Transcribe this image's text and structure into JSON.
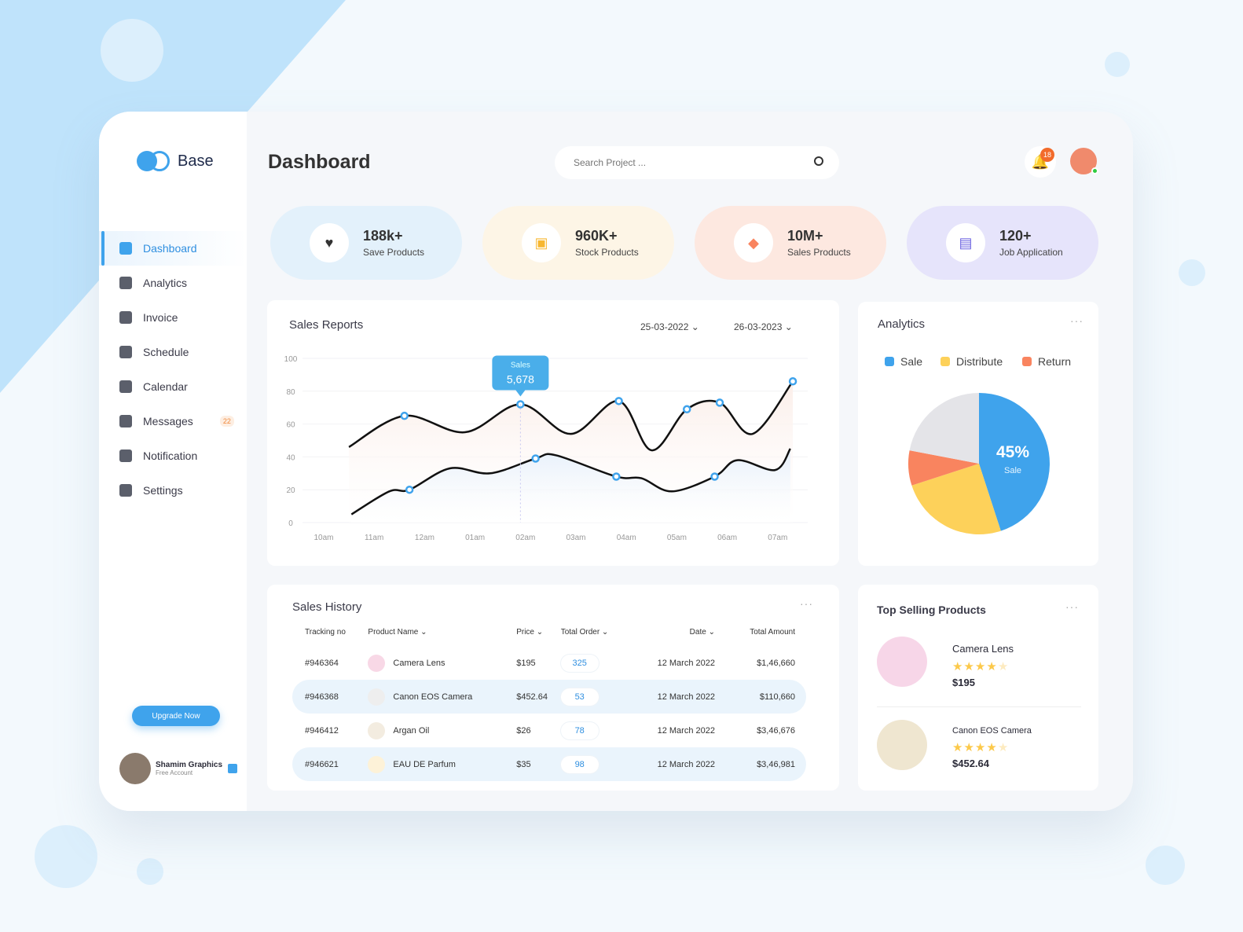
{
  "brand": "Base",
  "header": {
    "title": "Dashboard",
    "search_placeholder": "Search Project ...",
    "notification_count": "18"
  },
  "sidebar": {
    "items": [
      {
        "label": "Dashboard",
        "icon": "grid-icon",
        "active": true
      },
      {
        "label": "Analytics",
        "icon": "bar-chart-icon"
      },
      {
        "label": "Invoice",
        "icon": "invoice-icon"
      },
      {
        "label": "Schedule",
        "icon": "schedule-icon"
      },
      {
        "label": "Calendar",
        "icon": "calendar-icon"
      },
      {
        "label": "Messages",
        "icon": "messages-icon",
        "badge": "22"
      },
      {
        "label": "Notification",
        "icon": "bell-icon"
      },
      {
        "label": "Settings",
        "icon": "gear-icon"
      }
    ],
    "upgrade_label": "Upgrade Now",
    "user": {
      "name": "Shamim Graphics",
      "plan": "Free Account"
    }
  },
  "stats": [
    {
      "value": "188k+",
      "label": "Save Products",
      "icon": "heart-icon",
      "bg": "#e3f1fb"
    },
    {
      "value": "960K+",
      "label": "Stock Products",
      "icon": "box-icon",
      "bg": "#fdf5e6"
    },
    {
      "value": "10M+",
      "label": "Sales Products",
      "icon": "bag-icon",
      "bg": "#fde8e0"
    },
    {
      "value": "120+",
      "label": "Job Application",
      "icon": "briefcase-icon",
      "bg": "#e6e4fb"
    }
  ],
  "sales_report": {
    "title": "Sales Reports",
    "date_from": "25-03-2022",
    "date_to": "26-03-2023",
    "tooltip": {
      "label": "Sales",
      "value": "5,678"
    }
  },
  "chart_data": {
    "type": "line",
    "x_ticks": [
      "10am",
      "11am",
      "12am",
      "01am",
      "02am",
      "03am",
      "04am",
      "05am",
      "06am",
      "07am"
    ],
    "y_ticks": [
      0,
      20,
      40,
      60,
      80,
      100
    ],
    "ylim": [
      0,
      100
    ],
    "grid": true,
    "series": [
      {
        "color": "#111111",
        "fill": "#fbeee9",
        "points": [
          [
            0.5,
            46
          ],
          [
            1.6,
            65
          ],
          [
            2.8,
            55
          ],
          [
            3.9,
            72
          ],
          [
            4.9,
            54
          ],
          [
            5.85,
            74
          ],
          [
            6.5,
            44
          ],
          [
            7.2,
            69
          ],
          [
            7.85,
            73
          ],
          [
            8.5,
            54
          ],
          [
            9.3,
            86
          ]
        ],
        "markers": [
          1,
          3,
          5,
          7,
          8,
          10
        ]
      },
      {
        "color": "#111111",
        "fill": "#e6f0fb",
        "points": [
          [
            0.55,
            5
          ],
          [
            1.3,
            19
          ],
          [
            1.7,
            20
          ],
          [
            2.5,
            33
          ],
          [
            3.3,
            30
          ],
          [
            4.2,
            39
          ],
          [
            4.6,
            41
          ],
          [
            5.8,
            28
          ],
          [
            6.3,
            27
          ],
          [
            6.9,
            19
          ],
          [
            7.75,
            28
          ],
          [
            8.2,
            38
          ],
          [
            8.95,
            32
          ],
          [
            9.25,
            45
          ]
        ],
        "markers": [
          2,
          5,
          7,
          10
        ]
      }
    ]
  },
  "analytics": {
    "title": "Analytics",
    "legend": [
      {
        "label": "Sale",
        "color": "#3fa3ec"
      },
      {
        "label": "Distribute",
        "color": "#fdd15a"
      },
      {
        "label": "Return",
        "color": "#f9845f"
      }
    ],
    "pie": [
      {
        "label": "Sale",
        "value": 45,
        "color": "#3fa3ec"
      },
      {
        "label": "Distribute",
        "value": 25,
        "color": "#fdd15a"
      },
      {
        "label": "Return",
        "value": 8,
        "color": "#f9845f"
      },
      {
        "label": "",
        "value": 22,
        "color": "#e4e4e8"
      }
    ],
    "center_value": "45%",
    "center_label": "Sale"
  },
  "sales_history": {
    "title": "Sales History",
    "columns": [
      "Tracking no",
      "Product Name",
      "Price",
      "Total Order",
      "Date",
      "Total Amount"
    ],
    "rows": [
      {
        "tracking": "#946364",
        "product": "Camera Lens",
        "price": "$195",
        "orders": "325",
        "date": "12 March 2022",
        "amount": "$1,46,660"
      },
      {
        "tracking": "#946368",
        "product": "Canon EOS Camera",
        "price": "$452.64",
        "orders": "53",
        "date": "12 March 2022",
        "amount": "$110,660"
      },
      {
        "tracking": "#946412",
        "product": "Argan Oil",
        "price": "$26",
        "orders": "78",
        "date": "12 March 2022",
        "amount": "$3,46,676"
      },
      {
        "tracking": "#946621",
        "product": "EAU DE Parfum",
        "price": "$35",
        "orders": "98",
        "date": "12 March 2022",
        "amount": "$3,46,981"
      }
    ]
  },
  "top_selling": {
    "title": "Top Selling Products",
    "items": [
      {
        "name": "Camera Lens",
        "rating": 4,
        "price": "$195"
      },
      {
        "name": "Canon EOS Camera",
        "rating": 4,
        "price": "$452.64"
      }
    ]
  }
}
